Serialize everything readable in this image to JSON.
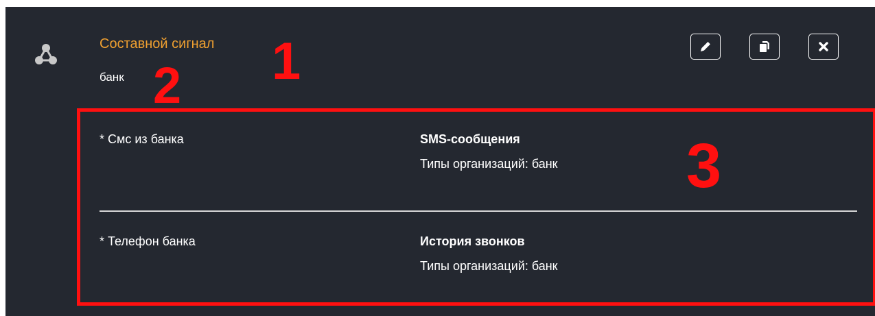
{
  "signal": {
    "title": "Составной сигнал",
    "subtitle": "банк",
    "type_icon": "network-nodes-icon"
  },
  "actions": [
    {
      "name": "edit",
      "icon": "pencil-icon"
    },
    {
      "name": "copy",
      "icon": "copy-icon"
    },
    {
      "name": "delete",
      "icon": "close-icon"
    }
  ],
  "annotations": {
    "label_1": "1",
    "label_2": "2",
    "label_3": "3",
    "color": "#ff1010"
  },
  "conditions": [
    {
      "name": "* Смс из банка",
      "source": "SMS-сообщения",
      "detail": "Типы организаций: банк"
    },
    {
      "name": "* Телефон банка",
      "source": "История звонков",
      "detail": "Типы организаций: банк"
    }
  ],
  "colors": {
    "panel_bg": "#242830",
    "title": "#f0a030",
    "text": "#ffffff"
  }
}
